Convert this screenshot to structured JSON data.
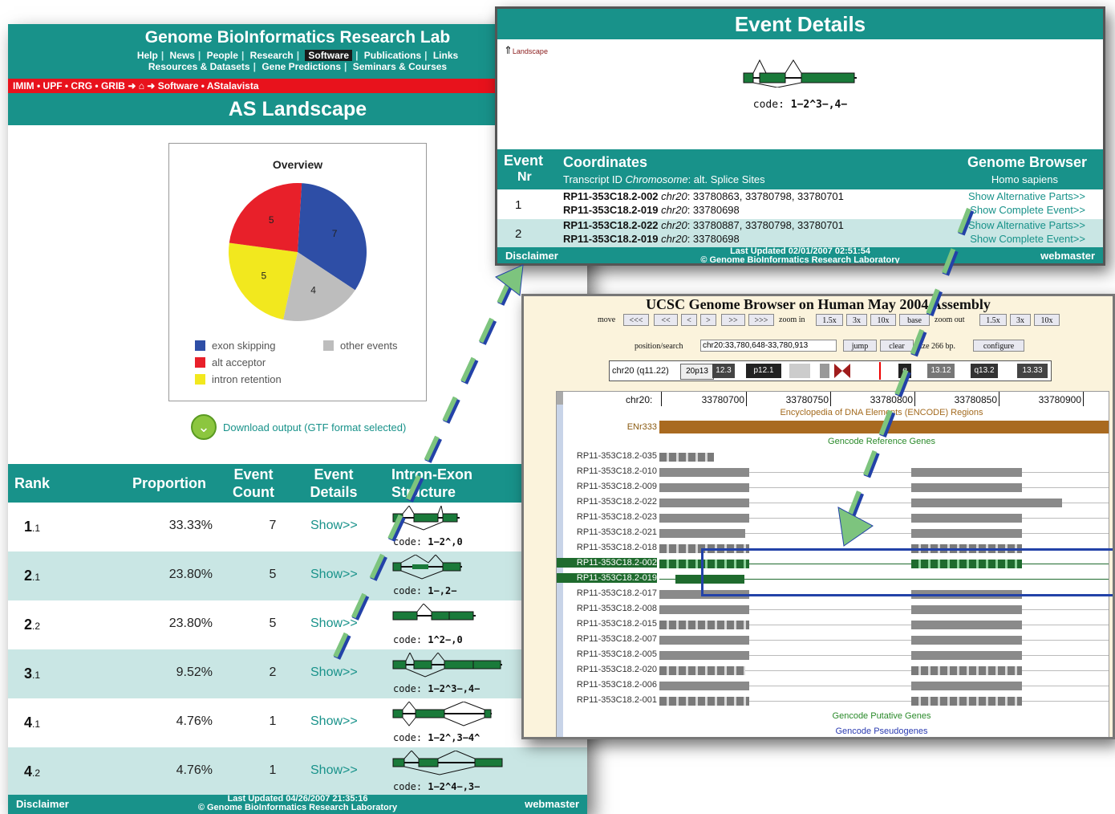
{
  "landscape": {
    "lab_title": "Genome BioInformatics Research Lab",
    "nav1": [
      "Help",
      "News",
      "People",
      "Research",
      "Software",
      "Publications",
      "Links"
    ],
    "nav1_selected": "Software",
    "nav2": [
      "Resources & Datasets",
      "Gene Predictions",
      "Seminars & Courses"
    ],
    "breadcrumb": [
      "IMIM",
      "UPF",
      "CRG",
      "GRIB",
      "Software",
      "AStalavista"
    ],
    "page_title": "AS Landscape",
    "chart_title": "Overview",
    "download_label": "Download output (GTF format selected)",
    "columns": [
      "Rank",
      "Proportion",
      "Event Count",
      "Event Details",
      "Intron-Exon Structure"
    ],
    "rows": [
      {
        "rank": "1",
        "sub": ".1",
        "proportion": "33.33%",
        "count": "7",
        "show": "Show>>",
        "code": "1−2^,0"
      },
      {
        "rank": "2",
        "sub": ".1",
        "proportion": "23.80%",
        "count": "5",
        "show": "Show>>",
        "code": "1−,2−"
      },
      {
        "rank": "2",
        "sub": ".2",
        "proportion": "23.80%",
        "count": "5",
        "show": "Show>>",
        "code": "1^2−,0"
      },
      {
        "rank": "3",
        "sub": ".1",
        "proportion": "9.52%",
        "count": "2",
        "show": "Show>>",
        "code": "1−2^3−,4−"
      },
      {
        "rank": "4",
        "sub": ".1",
        "proportion": "4.76%",
        "count": "1",
        "show": "Show>>",
        "code": "1−2^,3−4^"
      },
      {
        "rank": "4",
        "sub": ".2",
        "proportion": "4.76%",
        "count": "1",
        "show": "Show>>",
        "code": "1−2^4−,3−"
      }
    ],
    "code_label": "code:",
    "footer_left": "Disclaimer",
    "footer_mid1": "Last Updated 04/26/2007 21:35:16",
    "footer_mid2": "© Genome BioInformatics Research Laboratory",
    "footer_right": "webmaster"
  },
  "chart_data": {
    "type": "pie",
    "title": "Overview",
    "categories": [
      "exon skipping",
      "alt acceptor",
      "intron retention",
      "other events"
    ],
    "values": [
      7,
      5,
      5,
      4
    ],
    "colors": [
      "#2e4ea6",
      "#e8202a",
      "#f2e81e",
      "#bdbdbd"
    ],
    "legend_position": "bottom"
  },
  "event_details": {
    "title": "Event Details",
    "back_link": "Landscape",
    "code_label": "code:",
    "code": "1−2^3−,4−",
    "col_event": "Event",
    "col_nr": "Nr",
    "col_coords": "Coordinates",
    "col_coords_sub": "Transcript ID Chromosome: alt. Splice Sites",
    "col_gb": "Genome Browser",
    "col_gb_sub": "Homo sapiens",
    "rows": [
      {
        "nr": "1",
        "t1": "RP11-353C18.2-002",
        "c1": "chr20",
        "s1": "33780863, 33780798, 33780701",
        "t2": "RP11-353C18.2-019",
        "c2": "chr20",
        "s2": "33780698",
        "g1": "Show Alternative Parts>>",
        "g2": "Show Complete Event>>"
      },
      {
        "nr": "2",
        "t1": "RP11-353C18.2-022",
        "c1": "chr20",
        "s1": "33780887, 33780798, 33780701",
        "t2": "RP11-353C18.2-019",
        "c2": "chr20",
        "s2": "33780698",
        "g1": "Show Alternative Parts>>",
        "g2": "Show Complete Event>>"
      }
    ],
    "footer_left": "Disclaimer",
    "footer_mid1": "Last Updated 02/01/2007 02:51:54",
    "footer_mid2": "© Genome BioInformatics Research Laboratory",
    "footer_right": "webmaster"
  },
  "ucsc": {
    "title": "UCSC Genome Browser on Human May 2004 Assembly",
    "move_label": "move",
    "move_buttons": [
      "<<<",
      "<<",
      "<",
      ">",
      ">>",
      ">>>"
    ],
    "zoom_in_label": "zoom in",
    "zoom_in_buttons": [
      "1.5x",
      "3x",
      "10x",
      "base"
    ],
    "zoom_out_label": "zoom out",
    "zoom_out_buttons": [
      "1.5x",
      "3x",
      "10x"
    ],
    "position_label": "position/search",
    "position_value": "chr20:33,780,648-33,780,913",
    "jump": "jump",
    "clear": "clear",
    "size_text": "size 266 bp.",
    "configure": "configure",
    "ideogram_label": "chr20 (q11.22)",
    "ideogram_bands": [
      "20p13",
      "12.3",
      "p12.1",
      "q",
      "13.12",
      "q13.2",
      "13.33"
    ],
    "ruler_label": "chr20:",
    "ruler_ticks": [
      "33780700",
      "33780750",
      "33780800",
      "33780850",
      "33780900"
    ],
    "encode_title": "Encyclopedia of DNA Elements (ENCODE) Regions",
    "encode_track": "ENr333",
    "gencode_title": "Gencode Reference Genes",
    "tracks": [
      "RP11-353C18.2-035",
      "RP11-353C18.2-010",
      "RP11-353C18.2-009",
      "RP11-353C18.2-022",
      "RP11-353C18.2-023",
      "RP11-353C18.2-021",
      "RP11-353C18.2-018",
      "RP11-353C18.2-002",
      "RP11-353C18.2-019",
      "RP11-353C18.2-017",
      "RP11-353C18.2-008",
      "RP11-353C18.2-015",
      "RP11-353C18.2-007",
      "RP11-353C18.2-005",
      "RP11-353C18.2-020",
      "RP11-353C18.2-006",
      "RP11-353C18.2-001"
    ],
    "putative_title": "Gencode Putative Genes",
    "pseudo_title": "Gencode Pseudogenes"
  }
}
